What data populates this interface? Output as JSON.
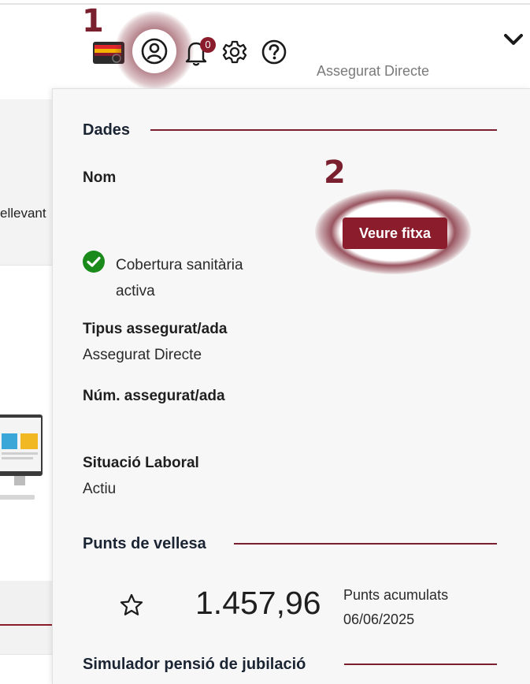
{
  "header": {
    "step1": "1",
    "step2": "2",
    "notifications_count": "0",
    "role_text": "Assegurat Directe",
    "icons": [
      "card-icon",
      "user-icon",
      "bell-icon",
      "gear-icon",
      "help-icon",
      "chevron-down-icon"
    ]
  },
  "background_page": {
    "partial_text": "ellevant"
  },
  "panel": {
    "dades_title": "Dades",
    "nom_label": "Nom",
    "veure_button": "Veure fitxa",
    "cobertura_text": "Cobertura sanitària activa",
    "tipus_label": "Tipus assegurat/ada",
    "tipus_value": "Assegurat Directe",
    "num_label": "Núm. assegurat/ada",
    "situacio_label": "Situació Laboral",
    "situacio_value": "Actiu",
    "punts_title": "Punts de vellesa",
    "punts_value": "1.457,96",
    "punts_label": "Punts acumulats",
    "punts_date": "06/06/2025",
    "simulador_title": "Simulador pensió de jubilació"
  },
  "colors": {
    "accent": "#8a1c2b",
    "success": "#1a8a1a",
    "panel_bg": "#f7f7f7"
  }
}
